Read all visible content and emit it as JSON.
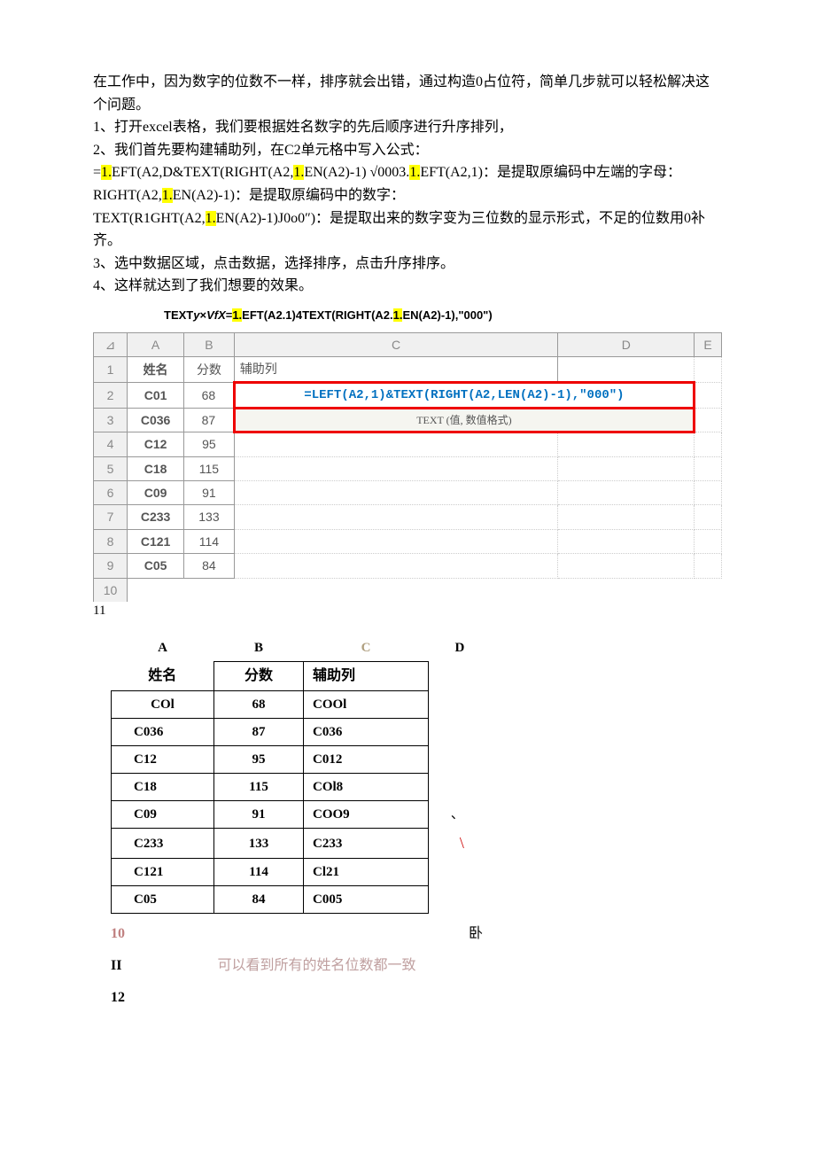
{
  "paragraphs": {
    "p1": "在工作中，因为数字的位数不一样，排序就会出错，通过构造0占位符，简单几步就可以轻松解决这个问题。",
    "p2": "1、打开excel表格，我们要根据姓名数字的先后顺序进行升序排列，",
    "p3": "2、我们首先要构建辅助列，在C2单元格中写入公式：",
    "p4_a": "=",
    "p4_b": "1.",
    "p4_c": "EFT(A2,D&TEXT(RIGHT(A2,",
    "p4_d": "1.",
    "p4_e": "EN(A2)-1) √0003.",
    "p4_f": "1.",
    "p4_g": "EFT(A2,1)：是提取原编码中左端的字母：RIGHT(A2,",
    "p4_h": "1.",
    "p4_i": "EN(A2)-1)：是提取原编码中的数字：",
    "p5_a": "TEXT(R1GHT(A2,",
    "p5_b": "1.",
    "p5_c": "EN(A2)-1)J0o0″)：是提取出来的数字变为三位数的显示形式，不足的位数用0补齐。",
    "p6": "3、选中数据区域，点击数据，选择排序，点击升序排序。",
    "p7": "4、这样就达到了我们想要的效果。"
  },
  "formula_title": {
    "left": "TEXT",
    "y": "y",
    "x1": "×",
    "vfx": "VfX",
    "eq": "=",
    "one": "1.",
    "mid1": "EFT(A2.1)4TEXT(RIGHT(A2.",
    "one2": "1.",
    "mid2": "EN(A2)-1),\"000\")"
  },
  "image1": {
    "colA": "A",
    "colB": "B",
    "colC": "C",
    "colD": "D",
    "colE": "E",
    "h1": "姓名",
    "h2": "分数",
    "h3": "辅助列",
    "formula_cell": "=LEFT(A2,1)&TEXT(RIGHT(A2,LEN(A2)-1),\"000\")",
    "tooltip": "TEXT (值, 数值格式)",
    "rows": [
      {
        "a": "C01",
        "b": "68"
      },
      {
        "a": "C036",
        "b": "87"
      },
      {
        "a": "C12",
        "b": "95"
      },
      {
        "a": "C18",
        "b": "115"
      },
      {
        "a": "C09",
        "b": "91"
      },
      {
        "a": "C233",
        "b": "133"
      },
      {
        "a": "C121",
        "b": "114"
      },
      {
        "a": "C05",
        "b": "84"
      }
    ],
    "eleven": "11"
  },
  "table2": {
    "colA": "A",
    "colB": "B",
    "colC": "C",
    "colD": "D",
    "h1": "姓名",
    "h2": "分数",
    "h3": "辅助列",
    "rows": [
      {
        "a": "COl",
        "b": "68",
        "c": "COOl"
      },
      {
        "a": "C036",
        "b": "87",
        "c": "C036"
      },
      {
        "a": "C12",
        "b": "95",
        "c": "C012"
      },
      {
        "a": "C18",
        "b": "115",
        "c": "COl8"
      },
      {
        "a": "C09",
        "b": "91",
        "c": "COO9"
      },
      {
        "a": "C233",
        "b": "133",
        "c": "C233"
      },
      {
        "a": "C121",
        "b": "114",
        "c": "Cl21"
      },
      {
        "a": "C05",
        "b": "84",
        "c": "C005"
      }
    ]
  },
  "footer": {
    "ten": "10",
    "wo": "卧",
    "ii": "II",
    "note": "可以看到所有的姓名位数都一致",
    "twelve": "12"
  }
}
